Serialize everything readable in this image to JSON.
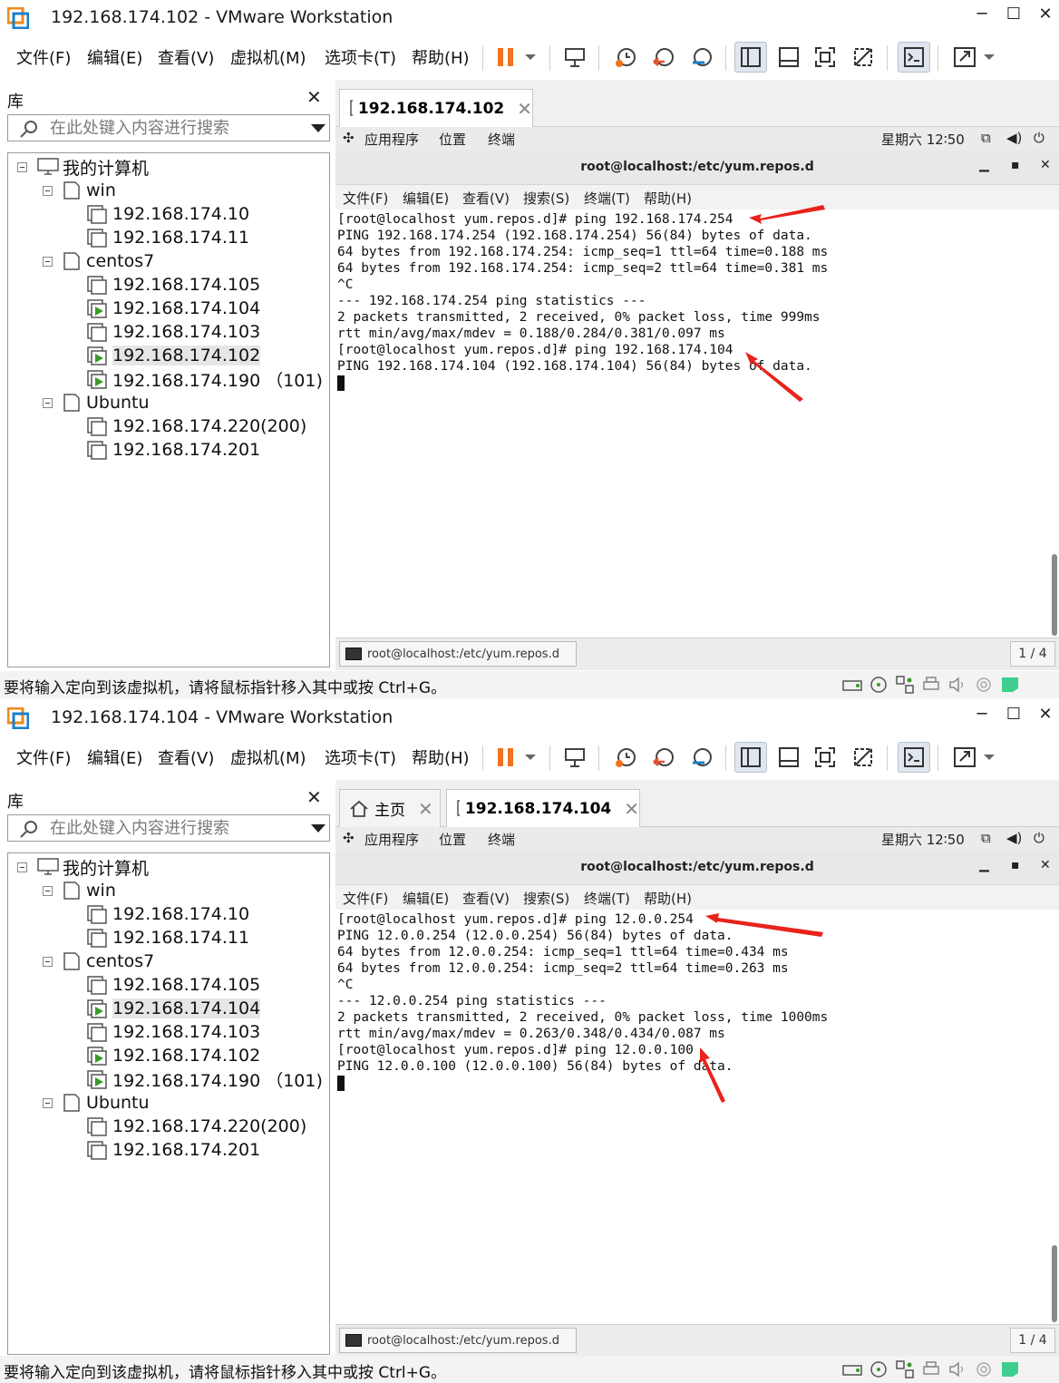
{
  "colors": {
    "accent": "#e8502e",
    "vm_running": "#3a9b2a",
    "arrow": "#e8231b",
    "pause": "#f07320"
  },
  "windows": [
    {
      "title": "192.168.174.102 - VMware Workstation",
      "menu": [
        "文件(F)",
        "编辑(E)",
        "查看(V)",
        "虚拟机(M)",
        "选项卡(T)",
        "帮助(H)"
      ],
      "library": {
        "title": "库",
        "search_placeholder": "在此处键入内容进行搜索",
        "root": "我的计算机",
        "groups": [
          {
            "name": "win",
            "items": [
              "192.168.174.10",
              "192.168.174.11"
            ]
          },
          {
            "name": "centos7",
            "items": [
              "192.168.174.105",
              "192.168.174.104",
              "192.168.174.103",
              "192.168.174.102",
              "192.168.174.190 （101)"
            ]
          },
          {
            "name": "Ubuntu",
            "items": [
              "192.168.174.220(200)",
              "192.168.174.201"
            ]
          }
        ]
      },
      "tabs": [
        {
          "label": "192.168.174.102",
          "active": true
        }
      ],
      "gnome": {
        "apps": "应用程序",
        "places": "位置",
        "terminal": "终端",
        "clock": "星期六 12∶50"
      },
      "terminal": {
        "title": "root@localhost:/etc/yum.repos.d",
        "menu": [
          "文件(F)",
          "编辑(E)",
          "查看(V)",
          "搜索(S)",
          "终端(T)",
          "帮助(H)"
        ],
        "lines": [
          "[root@localhost yum.repos.d]# ping 192.168.174.254",
          "PING 192.168.174.254 (192.168.174.254) 56(84) bytes of data.",
          "64 bytes from 192.168.174.254: icmp_seq=1 ttl=64 time=0.188 ms",
          "64 bytes from 192.168.174.254: icmp_seq=2 ttl=64 time=0.381 ms",
          "^C",
          "--- 192.168.174.254 ping statistics ---",
          "2 packets transmitted, 2 received, 0% packet loss, time 999ms",
          "rtt min/avg/max/mdev = 0.188/0.284/0.381/0.097 ms",
          "[root@localhost yum.repos.d]# ping 192.168.174.104",
          "PING 192.168.174.104 (192.168.174.104) 56(84) bytes of data."
        ],
        "task": "root@localhost:/etc/yum.repos.d",
        "pager": "1 / 4"
      },
      "status": "要将输入定向到该虚拟机，请将鼠标指针移入其中或按 Ctrl+G。"
    },
    {
      "title": "192.168.174.104 - VMware Workstation",
      "menu": [
        "文件(F)",
        "编辑(E)",
        "查看(V)",
        "虚拟机(M)",
        "选项卡(T)",
        "帮助(H)"
      ],
      "library": {
        "title": "库",
        "search_placeholder": "在此处键入内容进行搜索",
        "root": "我的计算机",
        "groups": [
          {
            "name": "win",
            "items": [
              "192.168.174.10",
              "192.168.174.11"
            ]
          },
          {
            "name": "centos7",
            "items": [
              "192.168.174.105",
              "192.168.174.104",
              "192.168.174.103",
              "192.168.174.102",
              "192.168.174.190 （101)"
            ]
          },
          {
            "name": "Ubuntu",
            "items": [
              "192.168.174.220(200)",
              "192.168.174.201"
            ]
          }
        ]
      },
      "tabs": [
        {
          "label": "主页",
          "active": false
        },
        {
          "label": "192.168.174.104",
          "active": true
        }
      ],
      "gnome": {
        "apps": "应用程序",
        "places": "位置",
        "terminal": "终端",
        "clock": "星期六 12∶50"
      },
      "terminal": {
        "title": "root@localhost:/etc/yum.repos.d",
        "menu": [
          "文件(F)",
          "编辑(E)",
          "查看(V)",
          "搜索(S)",
          "终端(T)",
          "帮助(H)"
        ],
        "lines": [
          "[root@localhost yum.repos.d]# ping 12.0.0.254",
          "PING 12.0.0.254 (12.0.0.254) 56(84) bytes of data.",
          "64 bytes from 12.0.0.254: icmp_seq=1 ttl=64 time=0.434 ms",
          "64 bytes from 12.0.0.254: icmp_seq=2 ttl=64 time=0.263 ms",
          "^C",
          "--- 12.0.0.254 ping statistics ---",
          "2 packets transmitted, 2 received, 0% packet loss, time 1000ms",
          "rtt min/avg/max/mdev = 0.263/0.348/0.434/0.087 ms",
          "[root@localhost yum.repos.d]# ping 12.0.0.100",
          "PING 12.0.0.100 (12.0.0.100) 56(84) bytes of data."
        ],
        "task": "root@localhost:/etc/yum.repos.d",
        "pager": "1 / 4"
      },
      "status": "要将输入定向到该虚拟机，请将鼠标指针移入其中或按 Ctrl+G。"
    }
  ]
}
